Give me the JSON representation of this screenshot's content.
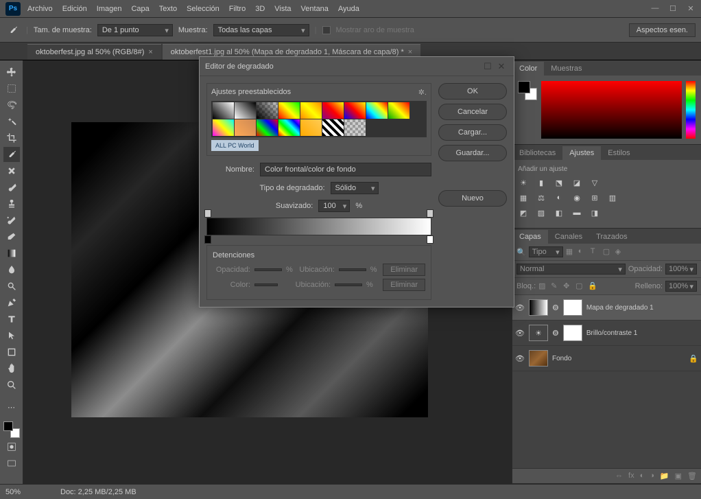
{
  "app": {
    "logo": "Ps"
  },
  "menu": [
    "Archivo",
    "Edición",
    "Imagen",
    "Capa",
    "Texto",
    "Selección",
    "Filtro",
    "3D",
    "Vista",
    "Ventana",
    "Ayuda"
  ],
  "optionbar": {
    "sampleSizeLabel": "Tam. de muestra:",
    "sampleSize": "De 1 punto",
    "sampleLabel": "Muestra:",
    "sample": "Todas las capas",
    "showRingLabel": "Mostrar aro de muestra",
    "workspace": "Aspectos esen."
  },
  "tabs": [
    {
      "title": "oktoberfest.jpg al 50% (RGB/8#)",
      "active": false
    },
    {
      "title": "oktoberfest1.jpg al 50% (Mapa de degradado 1, Máscara de capa/8) *",
      "active": true
    }
  ],
  "dialog": {
    "title": "Editor de degradado",
    "presetsLabel": "Ajustes preestablecidos",
    "watermark": "ALL PC World",
    "nameLabel": "Nombre:",
    "nameValue": "Color frontal/color de fondo",
    "typeLabel": "Tipo de degradado:",
    "typeValue": "Sólido",
    "smoothLabel": "Suavizado:",
    "smoothValue": "100",
    "pct": "%",
    "stopsLabel": "Detenciones",
    "opacityLabel": "Opacidad:",
    "locationLabel": "Ubicación:",
    "colorLabel": "Color:",
    "deleteLabel": "Eliminar",
    "buttons": {
      "ok": "OK",
      "cancel": "Cancelar",
      "load": "Cargar...",
      "save": "Guardar...",
      "new": "Nuevo"
    }
  },
  "panels": {
    "colorTabs": [
      "Color",
      "Muestras"
    ],
    "adjustTabs": [
      "Bibliotecas",
      "Ajustes",
      "Estilos"
    ],
    "adjustTitle": "Añadir un ajuste",
    "layerTabs": [
      "Capas",
      "Canales",
      "Trazados"
    ],
    "layerFilterLabel": "Tipo",
    "blendMode": "Normal",
    "opacityLabel": "Opacidad:",
    "opacityValue": "100%",
    "lockLabel": "Bloq.:",
    "fillLabel": "Relleno:",
    "fillValue": "100%",
    "layers": [
      {
        "name": "Mapa de degradado 1",
        "type": "grad",
        "selected": true
      },
      {
        "name": "Brillo/contraste 1",
        "type": "adj",
        "selected": false
      },
      {
        "name": "Fondo",
        "type": "img",
        "selected": false,
        "locked": true
      }
    ]
  },
  "statusbar": {
    "zoom": "50%",
    "doc": "Doc: 2,25 MB/2,25 MB"
  }
}
